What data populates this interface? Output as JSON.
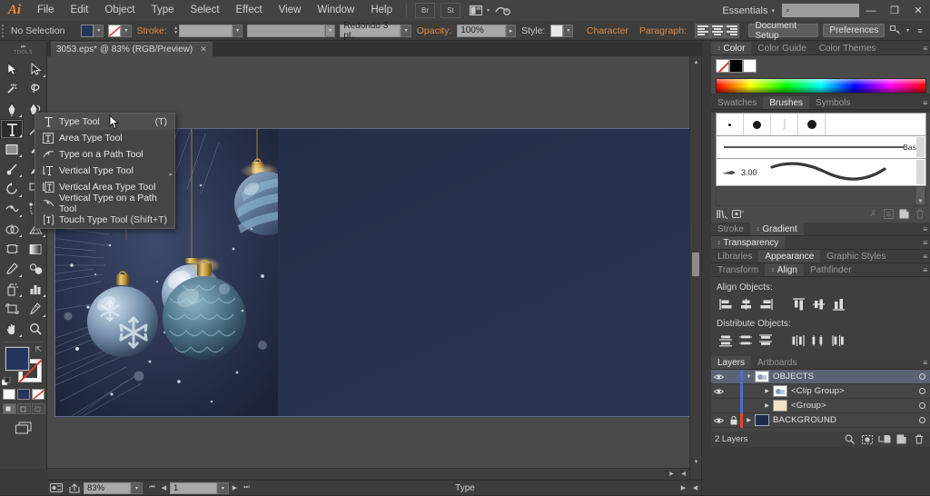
{
  "app": {
    "name": "Adobe Illustrator",
    "logo": "Ai"
  },
  "menubar": {
    "items": [
      "File",
      "Edit",
      "Object",
      "Type",
      "Select",
      "Effect",
      "View",
      "Window",
      "Help"
    ],
    "icons": [
      "bridge-icon",
      "stock-icon",
      "arrange-documents-icon",
      "sync-settings-icon"
    ],
    "workspace": "Essentials",
    "workspace_caret": "▾",
    "search_placeholder": "",
    "search_icon": "⌕",
    "window_buttons": {
      "minimize": "—",
      "restore": "❐",
      "close": "✕"
    }
  },
  "controlbar": {
    "selection_status": "No Selection",
    "fill_label": "fill-swatch",
    "fill_color": "#23355c",
    "stroke_swatch": "none-stroke-swatch",
    "stroke_label": "Stroke:",
    "stroke_weight": "",
    "stroke_profile": "",
    "brush_definition": "Redondo 3 pt.",
    "opacity_label": "Opacity:",
    "opacity_value": "100%",
    "style_label": "Style:",
    "character_label": "Character",
    "paragraph_label": "Paragraph:",
    "document_setup": "Document Setup",
    "preferences": "Preferences",
    "caret": "▾"
  },
  "toolbar": {
    "title": "TOOLS",
    "grip": "▸▸",
    "tools": [
      {
        "name": "selection-tool",
        "glyph": "selection"
      },
      {
        "name": "direct-selection-tool",
        "glyph": "direct"
      },
      {
        "name": "magic-wand-tool",
        "glyph": "wand"
      },
      {
        "name": "lasso-tool",
        "glyph": "lasso"
      },
      {
        "name": "pen-tool",
        "glyph": "pen"
      },
      {
        "name": "curvature-tool",
        "glyph": "curvature"
      },
      {
        "name": "type-tool",
        "glyph": "type"
      },
      {
        "name": "line-segment-tool",
        "glyph": "line"
      },
      {
        "name": "rectangle-tool",
        "glyph": "rect"
      },
      {
        "name": "paintbrush-tool",
        "glyph": "brush"
      },
      {
        "name": "shaper-tool",
        "glyph": "shaper"
      },
      {
        "name": "pencil-tool",
        "glyph": "pencil"
      },
      {
        "name": "rotate-tool",
        "glyph": "rotate"
      },
      {
        "name": "scale-tool",
        "glyph": "scale"
      },
      {
        "name": "width-tool",
        "glyph": "width"
      },
      {
        "name": "free-transform-tool",
        "glyph": "freetransform"
      },
      {
        "name": "shape-builder-tool",
        "glyph": "shapebuilder"
      },
      {
        "name": "perspective-grid-tool",
        "glyph": "perspective"
      },
      {
        "name": "mesh-tool",
        "glyph": "mesh"
      },
      {
        "name": "gradient-tool",
        "glyph": "gradient"
      },
      {
        "name": "eyedropper-tool",
        "glyph": "eyedropper"
      },
      {
        "name": "blend-tool",
        "glyph": "blend"
      },
      {
        "name": "symbol-sprayer-tool",
        "glyph": "sprayer"
      },
      {
        "name": "column-graph-tool",
        "glyph": "graph"
      },
      {
        "name": "artboard-tool",
        "glyph": "artboard"
      },
      {
        "name": "slice-tool",
        "glyph": "slice"
      },
      {
        "name": "hand-tool",
        "glyph": "hand"
      },
      {
        "name": "zoom-tool",
        "glyph": "zoom"
      }
    ],
    "fill_color": "#23355c",
    "stroke_color": "#ffffff",
    "modes": [
      "color-mode",
      "gradient-mode",
      "none-mode"
    ],
    "draw_modes": [
      "draw-normal",
      "draw-behind",
      "draw-inside"
    ],
    "screen_mode": "change-screen-mode"
  },
  "flyout_menu": {
    "items": [
      {
        "label": "Type Tool",
        "shortcut": "(T)",
        "icon": "type-tool-icon",
        "selected": true
      },
      {
        "label": "Area Type Tool",
        "shortcut": "",
        "icon": "area-type-tool-icon",
        "selected": false
      },
      {
        "label": "Type on a Path Tool",
        "shortcut": "",
        "icon": "type-on-path-tool-icon",
        "selected": false
      },
      {
        "label": "Vertical Type Tool",
        "shortcut": "",
        "icon": "vertical-type-tool-icon",
        "selected": false
      },
      {
        "label": "Vertical Area Type Tool",
        "shortcut": "",
        "icon": "vertical-area-type-tool-icon",
        "selected": false
      },
      {
        "label": "Vertical Type on a Path Tool",
        "shortcut": "",
        "icon": "vertical-type-on-path-tool-icon",
        "selected": false
      },
      {
        "label": "Touch Type Tool",
        "shortcut": "(Shift+T)",
        "icon": "touch-type-tool-icon",
        "selected": false
      }
    ]
  },
  "document": {
    "tab_title": "3053.eps* @ 83% (RGB/Preview)",
    "close_glyph": "✕"
  },
  "statusbar": {
    "zoom": "83%",
    "page": "1",
    "tool_status": "Type",
    "caret": "▾",
    "first": "⏮",
    "prev": "◀",
    "next": "▶",
    "last": "⏭"
  },
  "panels": {
    "color": {
      "tabs": [
        "Color",
        "Color Guide",
        "Color Themes"
      ],
      "active": "Color",
      "swatches": [
        "none",
        "#000000",
        "#ffffff"
      ]
    },
    "brushes": {
      "tabs": [
        "Swatches",
        "Brushes",
        "Symbols"
      ],
      "active": "Brushes",
      "entries": [
        {
          "name": "Basic",
          "size": ""
        },
        {
          "name": "",
          "size": "3.00"
        }
      ],
      "footer_icons": [
        "brush-libraries-icon",
        "libraries-panel-icon",
        "remove-brush-link-icon",
        "options-icon",
        "new-brush-icon",
        "delete-brush-icon"
      ]
    },
    "stroke_gradient": {
      "tabs": [
        "Stroke",
        "Gradient"
      ],
      "active": "Gradient"
    },
    "transparency": {
      "tabs": [
        "Transparency"
      ],
      "active": "Transparency"
    },
    "appearance": {
      "tabs": [
        "Libraries",
        "Appearance",
        "Graphic Styles"
      ],
      "active": "Appearance"
    },
    "align": {
      "tabs": [
        "Transform",
        "Align",
        "Pathfinder"
      ],
      "active": "Align",
      "align_objects_label": "Align Objects:",
      "distribute_objects_label": "Distribute Objects:",
      "align_buttons": [
        "align-left",
        "align-horizontal-center",
        "align-right",
        "align-top",
        "align-vertical-center",
        "align-bottom"
      ],
      "distribute_buttons": [
        "distribute-top",
        "distribute-vertical-center",
        "distribute-bottom",
        "distribute-left",
        "distribute-horizontal-center",
        "distribute-right"
      ]
    },
    "layers": {
      "tabs": [
        "Layers",
        "Artboards"
      ],
      "active": "Layers",
      "rows": [
        {
          "name": "OBJECTS",
          "visible": true,
          "locked": false,
          "color": "#4a6fc4",
          "expanded": true,
          "indent": 0,
          "selected": true,
          "thumb": "objects-thumb"
        },
        {
          "name": "<Clip Group>",
          "visible": true,
          "locked": false,
          "color": "#4a6fc4",
          "expanded": false,
          "indent": 1,
          "selected": false,
          "thumb": "clip-group-thumb"
        },
        {
          "name": "<Group>",
          "visible": false,
          "locked": false,
          "color": "#4a6fc4",
          "expanded": false,
          "indent": 1,
          "selected": false,
          "thumb": "group-thumb"
        },
        {
          "name": "BACKGROUND",
          "visible": true,
          "locked": true,
          "color": "#e0453a",
          "expanded": false,
          "indent": 0,
          "selected": false,
          "thumb": "background-thumb"
        }
      ],
      "footer_count": "2 Layers",
      "footer_icons": [
        "locate-object-icon",
        "make-mask-icon",
        "create-sublayer-icon",
        "new-layer-icon",
        "delete-layer-icon"
      ]
    },
    "menu_glyph": "≡"
  },
  "artwork": {
    "description": "christmas-ornaments-artwork",
    "background": "#27314d"
  }
}
